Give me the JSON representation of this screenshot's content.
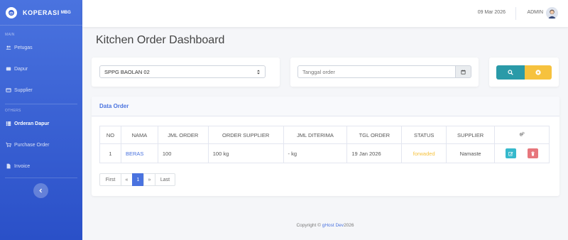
{
  "sidebar": {
    "brand": "KOPERASI",
    "brand_sup": "MBG",
    "sections": [
      {
        "title": "MAIN"
      },
      {
        "title": "OTHERS"
      }
    ],
    "items": [
      {
        "label": "Petugas"
      },
      {
        "label": "Dapur"
      },
      {
        "label": "Supplier"
      },
      {
        "label": "Orderan Dapur"
      },
      {
        "label": "Purchase Order"
      },
      {
        "label": "Invoice"
      }
    ]
  },
  "topbar": {
    "date": "09 Mar 2026",
    "user": "ADMIN"
  },
  "page": {
    "title": "Kitchen Order Dashboard"
  },
  "filters": {
    "kitchen_select": "SPPG BAOLAN 02",
    "date_placeholder": "Tanggal order"
  },
  "orders": {
    "card_title": "Data Order",
    "columns": [
      "NO",
      "NAMA",
      "JML ORDER",
      "ORDER SUPPLIER",
      "JML DITERIMA",
      "TGL ORDER",
      "STATUS",
      "SUPPLIER"
    ],
    "rows": [
      {
        "no": "1",
        "nama": "BERAS",
        "jml_order": "100",
        "order_supplier": "100 kg",
        "jml_diterima": "- kg",
        "tgl_order": "19 Jan 2026",
        "status": "forwaded",
        "supplier": "Namaste"
      }
    ],
    "pagination": {
      "first": "First",
      "prev": "«",
      "current": "1",
      "next": "»",
      "last": "Last"
    }
  },
  "footer": {
    "prefix": "Copyright ©",
    "brand": "gHost Dev",
    "year": "2026"
  },
  "colors": {
    "primary": "#4a73df",
    "info": "#36b9cc",
    "warning": "#f6c23e",
    "danger": "#e7767c",
    "teal": "#2a9aa8"
  }
}
